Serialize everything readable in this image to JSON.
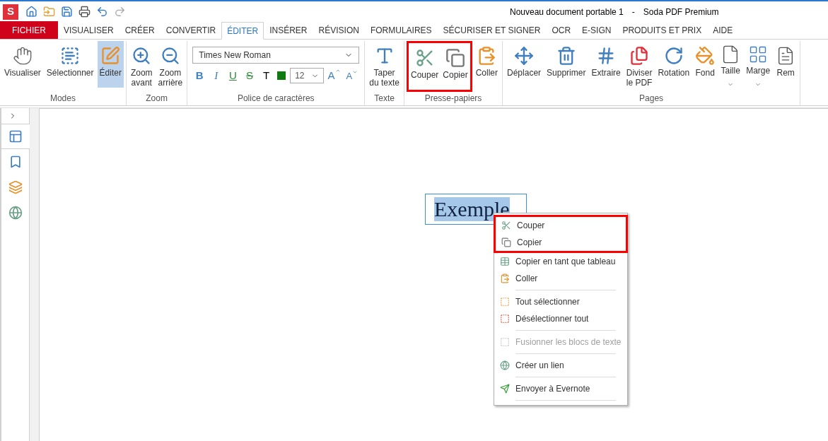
{
  "app_logo": "S",
  "title": {
    "document": "Nouveau document portable 1",
    "separator": "-",
    "app": "Soda PDF Premium"
  },
  "tabs": [
    {
      "label": "FICHIER",
      "kind": "file",
      "selected": false
    },
    {
      "label": "VISUALISER",
      "kind": "tab",
      "selected": false
    },
    {
      "label": "CRÉER",
      "kind": "tab",
      "selected": false
    },
    {
      "label": "CONVERTIR",
      "kind": "tab",
      "selected": false
    },
    {
      "label": "ÉDITER",
      "kind": "tab",
      "selected": true
    },
    {
      "label": "INSÉRER",
      "kind": "tab",
      "selected": false
    },
    {
      "label": "RÉVISION",
      "kind": "tab",
      "selected": false
    },
    {
      "label": "FORMULAIRES",
      "kind": "tab",
      "selected": false
    },
    {
      "label": "SÉCURISER ET SIGNER",
      "kind": "tab",
      "selected": false
    },
    {
      "label": "OCR",
      "kind": "tab",
      "selected": false
    },
    {
      "label": "E-SIGN",
      "kind": "tab",
      "selected": false
    },
    {
      "label": "PRODUITS ET PRIX",
      "kind": "tab",
      "selected": false
    },
    {
      "label": "AIDE",
      "kind": "tab",
      "selected": false
    }
  ],
  "ribbon": {
    "modes": {
      "label": "Modes",
      "buttons": [
        {
          "label": "Visualiser",
          "selected": false
        },
        {
          "label": "Sélectionner",
          "selected": false
        },
        {
          "label": "Éditer",
          "selected": true
        }
      ]
    },
    "zoom": {
      "label": "Zoom",
      "buttons": [
        {
          "label": "Zoom\navant"
        },
        {
          "label": "Zoom\narrière"
        }
      ]
    },
    "font": {
      "label": "Police de caractères",
      "font_name": "Times New Roman",
      "size": "12",
      "format_buttons": [
        {
          "label": "B",
          "kind": "bold"
        },
        {
          "label": "I",
          "kind": "italic"
        },
        {
          "label": "U",
          "kind": "underline"
        },
        {
          "label": "S",
          "kind": "strike"
        },
        {
          "label": "T",
          "kind": "color_text"
        },
        {
          "kind": "swatch"
        }
      ],
      "size_buttons": [
        {
          "label": "A",
          "kind": "grow"
        },
        {
          "label": "A",
          "kind": "shrink"
        }
      ]
    },
    "text": {
      "label": "Texte",
      "buttons": [
        {
          "label": "Taper\ndu texte"
        }
      ]
    },
    "clipboard": {
      "label": "Presse-papiers",
      "buttons": [
        {
          "label": "Couper",
          "highlighted": true
        },
        {
          "label": "Copier",
          "highlighted": true
        },
        {
          "label": "Coller",
          "highlighted": false
        }
      ]
    },
    "pages": {
      "label": "Pages",
      "buttons": [
        {
          "label": "Déplacer",
          "dropdown": false
        },
        {
          "label": "Supprimer",
          "dropdown": false
        },
        {
          "label": "Extraire",
          "dropdown": false
        },
        {
          "label": "Diviser\nle PDF",
          "dropdown": false
        },
        {
          "label": "Rotation",
          "dropdown": false
        },
        {
          "label": "Fond",
          "dropdown": false
        },
        {
          "label": "Taille",
          "dropdown": true
        },
        {
          "label": "Marge",
          "dropdown": true
        },
        {
          "label": "Rem",
          "dropdown": false
        }
      ]
    }
  },
  "sidebar": {
    "tabs": [
      {
        "selected": true
      },
      {
        "selected": false
      },
      {
        "selected": false
      },
      {
        "selected": false
      }
    ]
  },
  "canvas": {
    "text_box": "Exemple"
  },
  "context_menu": [
    {
      "kind": "item",
      "label": "Couper",
      "disabled": false,
      "highlighted": true
    },
    {
      "kind": "item",
      "label": "Copier",
      "disabled": false,
      "highlighted": true
    },
    {
      "kind": "item",
      "label": "Copier en tant que tableau",
      "disabled": false,
      "highlighted": false
    },
    {
      "kind": "item",
      "label": "Coller",
      "disabled": false,
      "highlighted": false
    },
    {
      "kind": "separator"
    },
    {
      "kind": "item",
      "label": "Tout sélectionner",
      "disabled": false,
      "highlighted": false
    },
    {
      "kind": "item",
      "label": "Désélectionner tout",
      "disabled": false,
      "highlighted": false
    },
    {
      "kind": "separator"
    },
    {
      "kind": "item",
      "label": "Fusionner les blocs de texte",
      "disabled": true,
      "highlighted": false
    },
    {
      "kind": "separator"
    },
    {
      "kind": "item",
      "label": "Créer un lien",
      "disabled": false,
      "highlighted": false
    },
    {
      "kind": "separator"
    },
    {
      "kind": "item",
      "label": "Envoyer à Evernote",
      "disabled": false,
      "highlighted": false
    },
    {
      "kind": "separator"
    }
  ]
}
